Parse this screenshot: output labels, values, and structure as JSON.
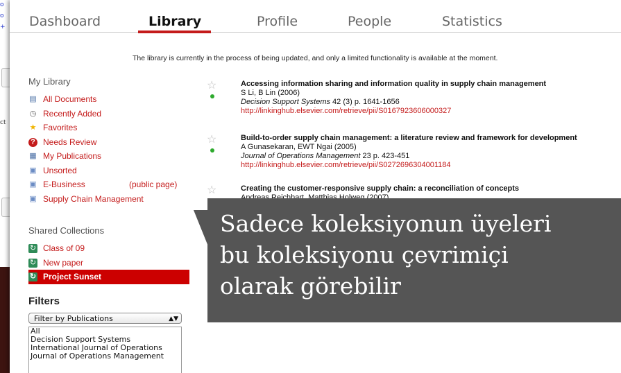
{
  "tabs": [
    {
      "label": "Dashboard"
    },
    {
      "label": "Library"
    },
    {
      "label": "Profile"
    },
    {
      "label": "People"
    },
    {
      "label": "Statistics"
    }
  ],
  "notice": "The library is currently in the process of being updated, and only a limited functionality is available at the moment.",
  "sidebar": {
    "my_library_title": "My Library",
    "my_library": [
      {
        "label": "All Documents",
        "icon": "documents-icon"
      },
      {
        "label": "Recently Added",
        "icon": "clock-icon"
      },
      {
        "label": "Favorites",
        "icon": "star-icon"
      },
      {
        "label": "Needs Review",
        "icon": "review-icon"
      },
      {
        "label": "My Publications",
        "icon": "publications-icon"
      },
      {
        "label": "Unsorted",
        "icon": "folder-icon"
      },
      {
        "label": "E-Business",
        "icon": "folder-icon",
        "extra": "(public page)"
      },
      {
        "label": "Supply Chain Management",
        "icon": "folder-icon"
      }
    ],
    "shared_title": "Shared Collections",
    "shared": [
      {
        "label": "Class of 09"
      },
      {
        "label": "New paper"
      },
      {
        "label": "Project Sunset"
      }
    ],
    "filters_title": "Filters",
    "filter_select": "Filter by Publications",
    "filter_options": [
      "All",
      "Decision Support Systems",
      "International Journal of Operations",
      "Journal of Operations Management"
    ]
  },
  "documents": [
    {
      "title": "Accessing information sharing and information quality in supply chain management",
      "authors": "S Li, B Lin (2006)",
      "journal": "Decision Support Systems",
      "citation": " 42 (3) p. 1641-1656",
      "url": "http://linkinghub.elsevier.com/retrieve/pii/S0167923606000327"
    },
    {
      "title": "Build-to-order supply chain management: a literature review and framework for development",
      "authors": "A Gunasekaran, EWT Ngai (2005)",
      "journal": "Journal of Operations Management",
      "citation": " 23 p. 423-451",
      "url": "http://linkinghub.elsevier.com/retrieve/pii/S0272696304001184"
    },
    {
      "title": "Creating the customer-responsive supply chain: a reconciliation of concepts",
      "authors": "Andreas Reichhart, Matthias Holweg (2007)"
    }
  ],
  "tooltip": {
    "line1": "Sadece koleksiyonun üyeleri",
    "line2": "bu koleksiyonu çevrimiçi",
    "line3": "olarak görebilir"
  },
  "colors": {
    "accent": "#c41b1b",
    "tooltip_bg": "#555555",
    "backdrop": "#3d1410"
  }
}
